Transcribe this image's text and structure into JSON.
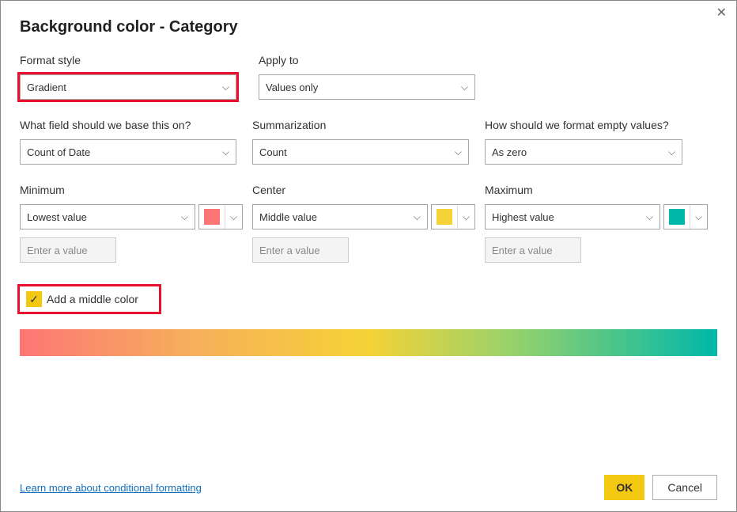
{
  "dialog": {
    "title": "Background color - Category",
    "close_icon": "✕"
  },
  "row1": {
    "format_style": {
      "label": "Format style",
      "value": "Gradient"
    },
    "apply_to": {
      "label": "Apply to",
      "value": "Values only"
    }
  },
  "row2": {
    "base_field": {
      "label": "What field should we base this on?",
      "value": "Count of Date"
    },
    "summarization": {
      "label": "Summarization",
      "value": "Count"
    },
    "empty": {
      "label": "How should we format empty values?",
      "value": "As zero"
    }
  },
  "row3": {
    "minimum": {
      "label": "Minimum",
      "value": "Lowest value",
      "placeholder": "Enter a value",
      "color": "#FD7675"
    },
    "center": {
      "label": "Center",
      "value": "Middle value",
      "placeholder": "Enter a value",
      "color": "#F5D235"
    },
    "maximum": {
      "label": "Maximum",
      "value": "Highest value",
      "placeholder": "Enter a value",
      "color": "#00B8A9"
    }
  },
  "middle_color": {
    "label": "Add a middle color",
    "checked": true
  },
  "footer": {
    "learn_link": "Learn more about conditional formatting",
    "ok": "OK",
    "cancel": "Cancel"
  }
}
